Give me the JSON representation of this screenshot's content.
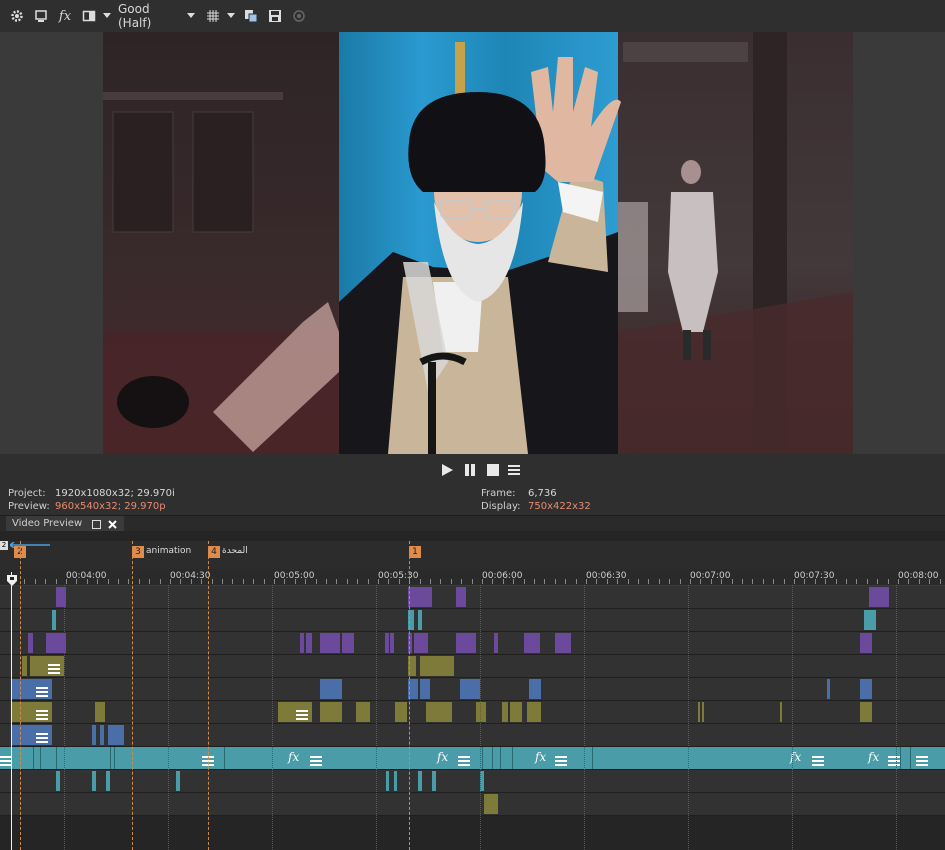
{
  "toolbar": {
    "icons": [
      "gear-icon",
      "preview-device-icon",
      "fx-icon",
      "split-screen-icon",
      "chevron-down-icon",
      "overlay-grid-icon",
      "chevron-down-icon",
      "copy-snapshot-icon",
      "save-snapshot-icon",
      "sync-icon"
    ],
    "fx_label": "fx",
    "quality_label": "Good (Half)"
  },
  "transport": {
    "icons": [
      "play-icon",
      "pause-icon",
      "stop-icon",
      "menu-icon"
    ]
  },
  "info": {
    "project_label": "Project:",
    "project_value": "1920x1080x32; 29.970i",
    "preview_label": "Preview:",
    "preview_value": "960x540x32; 29.970p",
    "frame_label": "Frame:",
    "frame_value": "6,736",
    "display_label": "Display:",
    "display_value": "750x422x32"
  },
  "tab": {
    "label": "Video Preview"
  },
  "timeline": {
    "markers": [
      {
        "num": "2",
        "label": ""
      },
      {
        "num": "3",
        "label": "animation"
      },
      {
        "num": "4",
        "label": "المحدة"
      },
      {
        "num": "1",
        "label": ""
      }
    ],
    "ruler_labels": [
      "00:04:00",
      "00:04:30",
      "00:05:00",
      "00:05:30",
      "00:06:00",
      "00:06:30",
      "00:07:00",
      "00:07:30",
      "00:08:00"
    ],
    "fx_label": "fx"
  },
  "colors": {
    "purple": "#6b4a9c",
    "teal": "#4a9ca8",
    "olive": "#7e7a3a",
    "blue": "#4a6ea8",
    "marker": "#e08a4c"
  }
}
